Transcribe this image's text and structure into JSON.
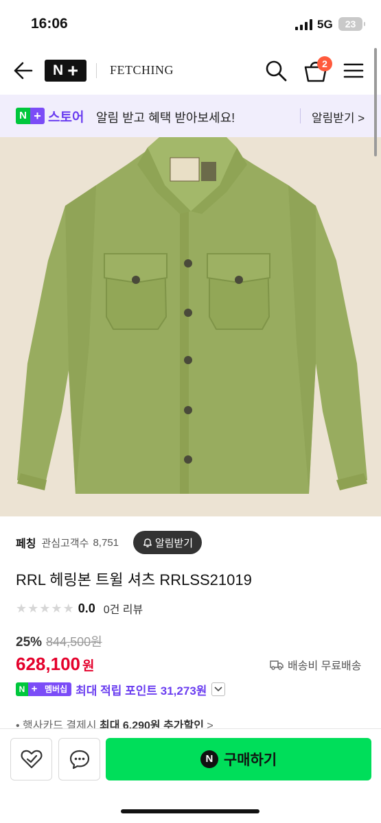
{
  "status_bar": {
    "time": "16:06",
    "network": "5G",
    "battery": "23"
  },
  "header": {
    "store_name": "FETCHING",
    "cart_count": "2",
    "logo_n": "N",
    "logo_plus": "+"
  },
  "promo": {
    "logo_n": "N",
    "logo_plus": "+",
    "store_label": "스토어",
    "message": "알림 받고 혜택 받아보세요!",
    "cta": "알림받기 >"
  },
  "product": {
    "seller": "페칭",
    "fav_label": "관심고객수",
    "fav_count": "8,751",
    "alarm_button": "알림받기",
    "title": "RRL 헤링본 트윌 셔츠 RRLSS21019",
    "rating": "0.0",
    "reviews": "0건 리뷰",
    "discount": "25%",
    "original_price": "844,500원",
    "price": "628,100",
    "price_unit": "원",
    "shipping": "배송비 무료배송",
    "member_badge": "멤버십",
    "member_points": "최대 적립 포인트 31,273원",
    "card_prefix": "• 행사카드 결제시 ",
    "card_bold": "최대 6,290원 추가할인",
    "card_suffix": " >"
  },
  "colors": {
    "accent_green": "#00de5a",
    "naver_green": "#00c73c",
    "purple": "#7b4cf7",
    "sale_red": "#e4002b",
    "image_bg": "#ece3d3",
    "shirt": "#98ac5f"
  },
  "icons": [
    "back-arrow-icon",
    "search-icon",
    "cart-icon",
    "menu-icon",
    "bell-icon",
    "truck-icon",
    "chevron-down-icon",
    "heart-check-icon",
    "chat-icon"
  ],
  "bottom_bar": {
    "buy_label": "구매하기",
    "buy_icon_letter": "N"
  }
}
